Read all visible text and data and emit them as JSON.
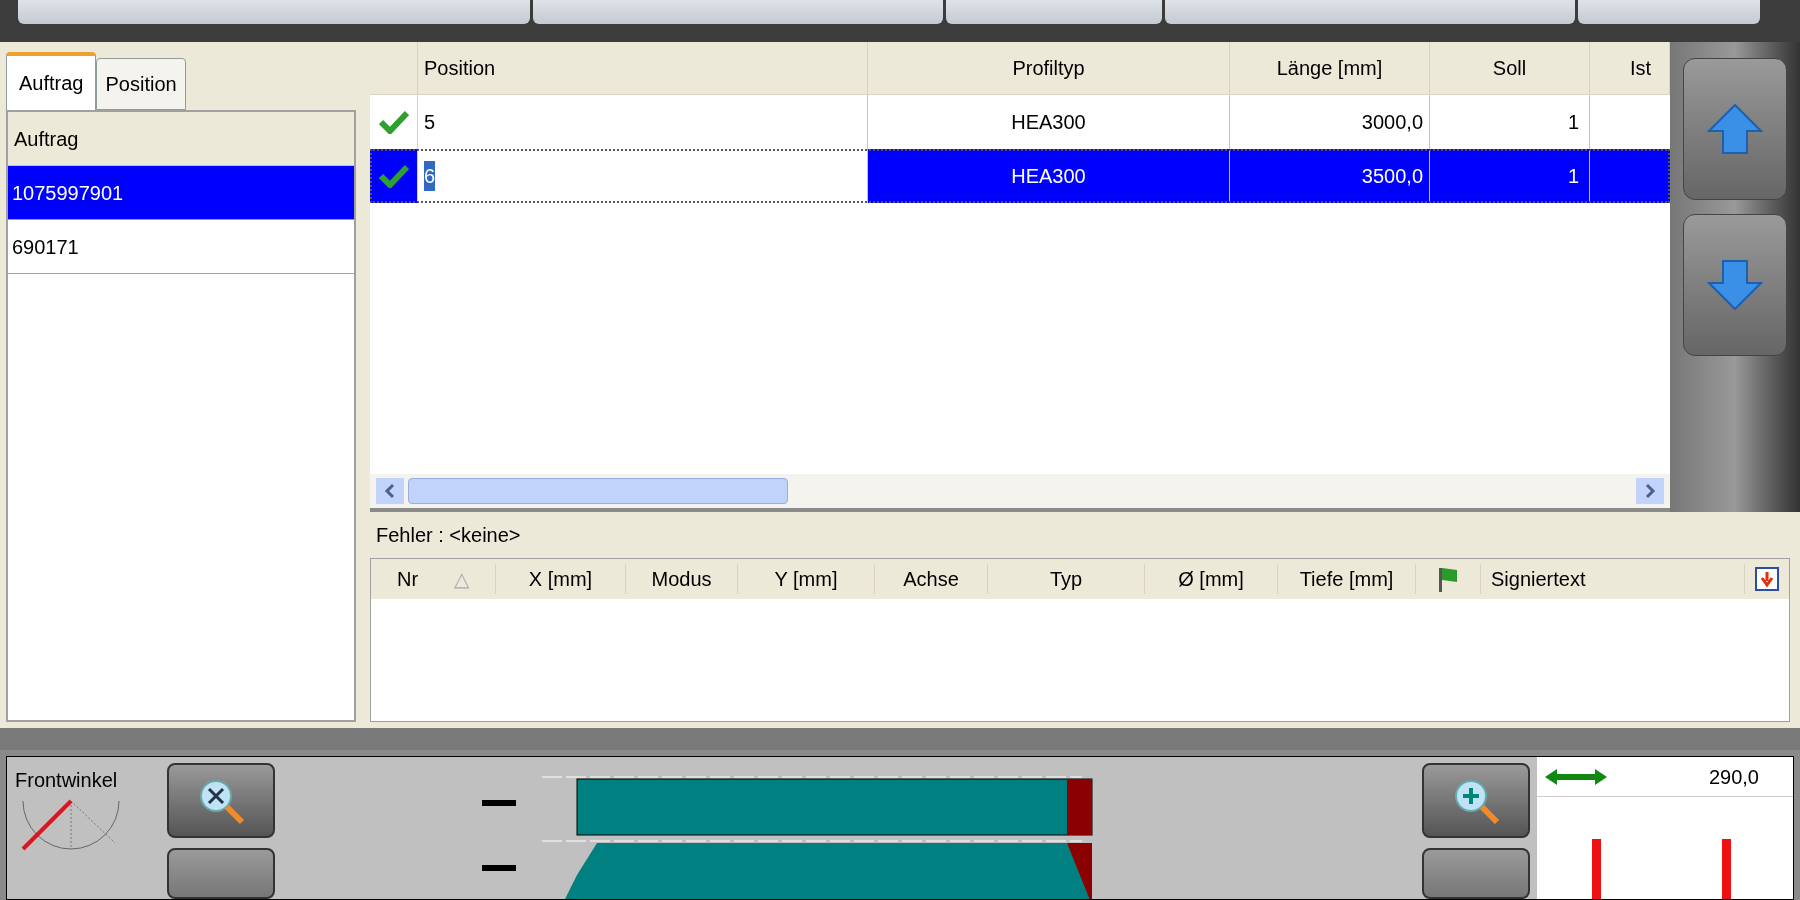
{
  "tabs": [
    {
      "label": "Auftrag",
      "selected": true
    },
    {
      "label": "Position",
      "selected": false
    }
  ],
  "order_list": {
    "header": "Auftrag",
    "items": [
      {
        "label": "1075997901",
        "selected": true
      },
      {
        "label": "690171",
        "selected": false
      }
    ]
  },
  "positions_table": {
    "columns": [
      "Position",
      "Profiltyp",
      "Länge [mm]",
      "Soll",
      "Ist"
    ],
    "rows": [
      {
        "done": true,
        "selected": false,
        "cells": [
          "5",
          "HEA300",
          "3000,0",
          "1"
        ]
      },
      {
        "done": true,
        "selected": true,
        "cells": [
          "6",
          "HEA300",
          "3500,0",
          "1"
        ]
      }
    ]
  },
  "error_label": "Fehler : <keine>",
  "holes_table": {
    "columns": [
      {
        "kind": "text",
        "label": "Nr",
        "sort_indicator": "△"
      },
      {
        "kind": "text",
        "label": "X [mm]"
      },
      {
        "kind": "text",
        "label": "Modus"
      },
      {
        "kind": "text",
        "label": "Y [mm]"
      },
      {
        "kind": "text",
        "label": "Achse"
      },
      {
        "kind": "text",
        "label": "Typ"
      },
      {
        "kind": "text",
        "label": "Ø [mm]"
      },
      {
        "kind": "text",
        "label": "Tiefe [mm]"
      },
      {
        "kind": "flag"
      },
      {
        "kind": "text",
        "label": "Signiertext"
      }
    ]
  },
  "bottom_panel": {
    "front_angle_label": "Frontwinkel",
    "length_value": "290,0"
  }
}
